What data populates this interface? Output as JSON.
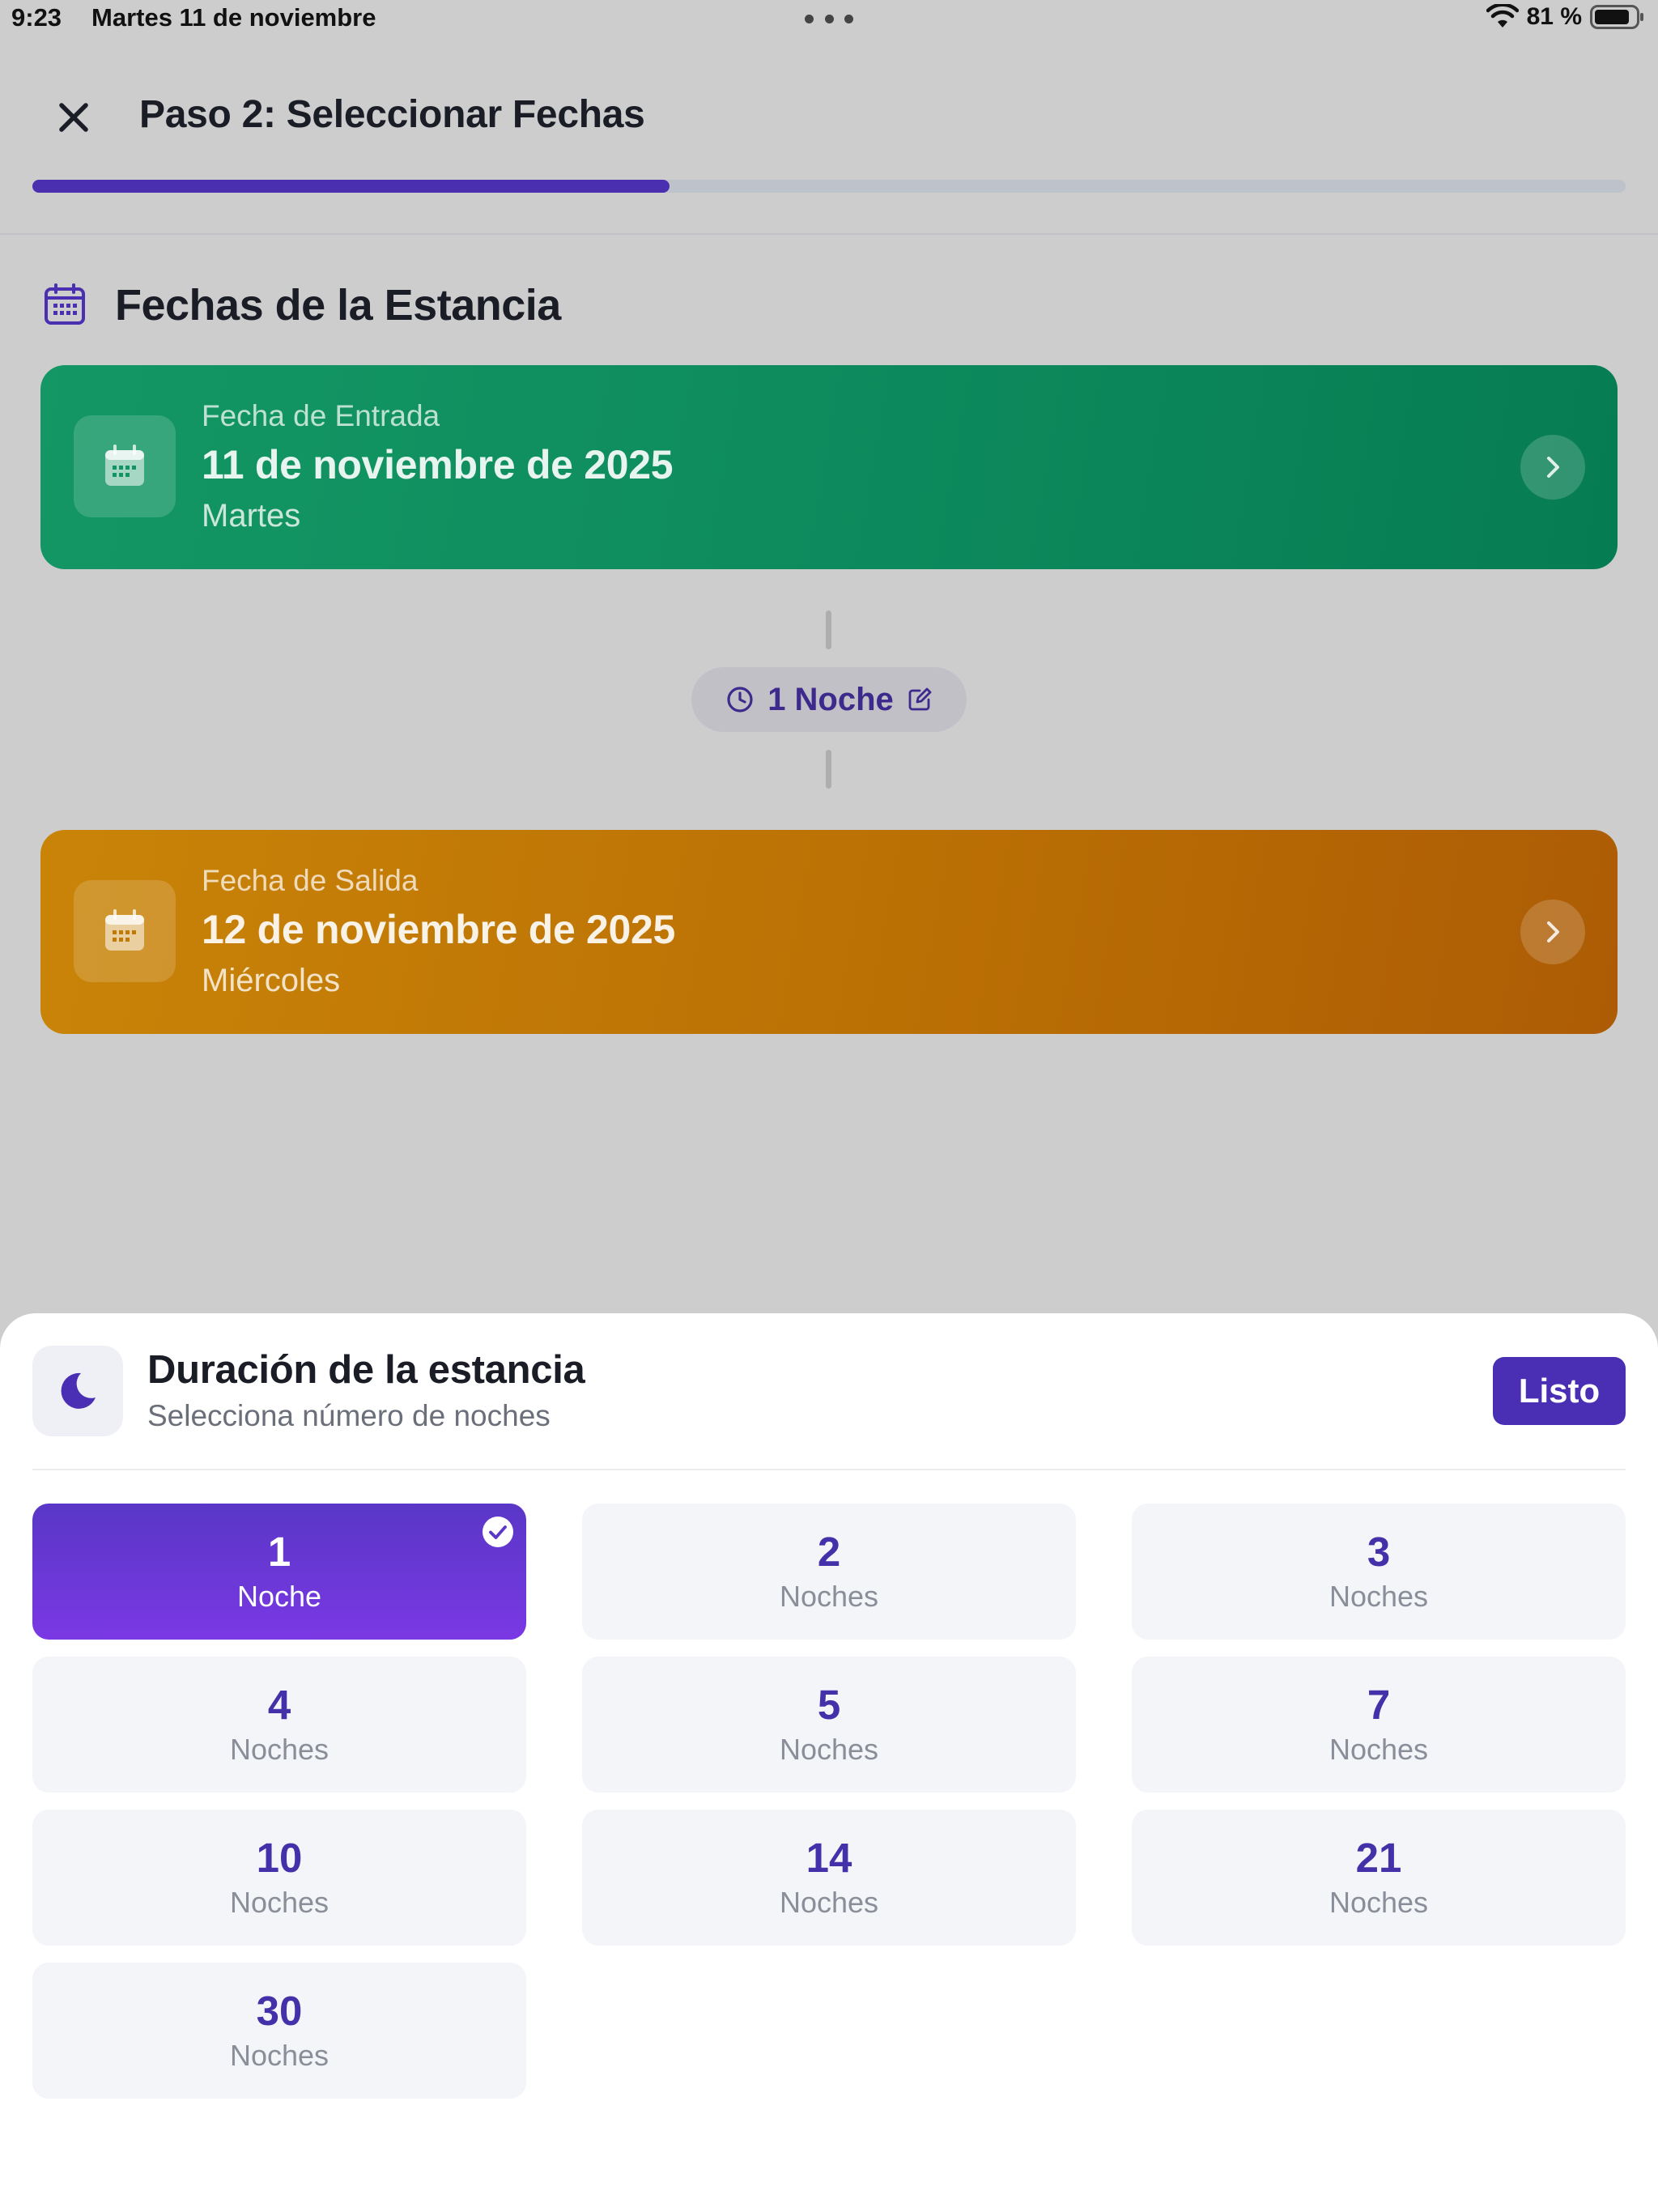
{
  "status_bar": {
    "time": "9:23",
    "date": "Martes 11 de noviembre",
    "battery": "81 %"
  },
  "header": {
    "title": "Paso 2: Seleccionar Fechas",
    "progress": 0.4,
    "accent_color": "#4a2fb0"
  },
  "section": {
    "title": "Fechas de la Estancia",
    "icon": "calendar-icon"
  },
  "checkin": {
    "label": "Fecha de Entrada",
    "date": "11 de noviembre de 2025",
    "weekday": "Martes",
    "color": "#0d8a5d"
  },
  "duration_pill": {
    "label": "1 Noche",
    "icon": "clock-icon",
    "edit_icon": "edit-icon"
  },
  "checkout": {
    "label": "Fecha de Salida",
    "date": "12 de noviembre de 2025",
    "weekday": "Miércoles",
    "color": "#bb7004"
  },
  "sheet": {
    "title": "Duración de la estancia",
    "subtitle": "Selecciona número de noches",
    "done_label": "Listo",
    "icon": "moon-icon",
    "options": [
      {
        "number": "1",
        "unit": "Noche",
        "selected": true
      },
      {
        "number": "2",
        "unit": "Noches",
        "selected": false
      },
      {
        "number": "3",
        "unit": "Noches",
        "selected": false
      },
      {
        "number": "4",
        "unit": "Noches",
        "selected": false
      },
      {
        "number": "5",
        "unit": "Noches",
        "selected": false
      },
      {
        "number": "7",
        "unit": "Noches",
        "selected": false
      },
      {
        "number": "10",
        "unit": "Noches",
        "selected": false
      },
      {
        "number": "14",
        "unit": "Noches",
        "selected": false
      },
      {
        "number": "21",
        "unit": "Noches",
        "selected": false
      },
      {
        "number": "30",
        "unit": "Noches",
        "selected": false
      }
    ]
  }
}
